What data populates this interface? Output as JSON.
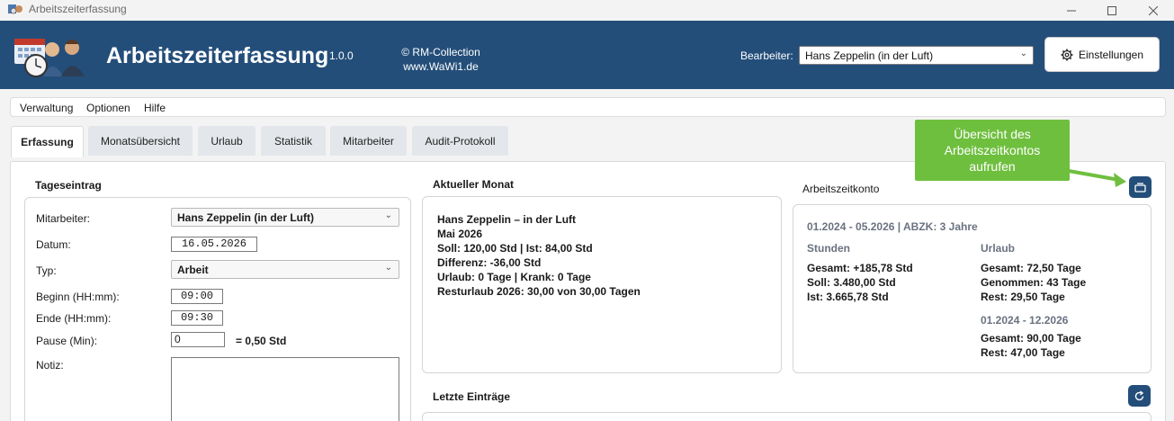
{
  "window": {
    "title": "Arbeitszeiterfassung"
  },
  "header": {
    "app_title": "Arbeitszeiterfassung",
    "version": "1.0.0",
    "copyright_line1": "© RM-Collection",
    "copyright_line2": "www.WaWi1.de",
    "editor_label": "Bearbeiter:",
    "editor_value": "Hans Zeppelin (in der Luft)",
    "settings_label": "Einstellungen"
  },
  "menu": {
    "items": [
      "Verwaltung",
      "Optionen",
      "Hilfe"
    ]
  },
  "tabs": [
    {
      "label": "Erfassung",
      "active": true
    },
    {
      "label": "Monatsübersicht",
      "active": false
    },
    {
      "label": "Urlaub",
      "active": false
    },
    {
      "label": "Statistik",
      "active": false
    },
    {
      "label": "Mitarbeiter",
      "active": false
    },
    {
      "label": "Audit-Protokoll",
      "active": false
    }
  ],
  "entry": {
    "title": "Tageseintrag",
    "employee_label": "Mitarbeiter:",
    "employee_value": "Hans Zeppelin (in der Luft)",
    "date_label": "Datum:",
    "date_value": "16.05.2026",
    "type_label": "Typ:",
    "type_value": "Arbeit",
    "start_label": "Beginn (HH:mm):",
    "start_value": "09:00",
    "end_label": "Ende (HH:mm):",
    "end_value": "09:30",
    "pause_label": "Pause (Min):",
    "pause_value": "0",
    "pause_result": "= 0,50 Std",
    "note_label": "Notiz:"
  },
  "month": {
    "title": "Aktueller Monat",
    "lines": [
      "Hans Zeppelin – in der Luft",
      "Mai 2026",
      "Soll: 120,00 Std  |  Ist: 84,00 Std",
      "Differenz: -36,00 Std",
      "Urlaub: 0 Tage  |  Krank: 0 Tage",
      "Resturlaub 2026: 30,00 von 30,00 Tagen"
    ]
  },
  "account": {
    "title": "Arbeitszeitkonto",
    "period": "01.2024 - 05.2026  |  ABZK: 3 Jahre",
    "hours_title": "Stunden",
    "hours_lines": [
      "Gesamt: +185,78 Std",
      "Soll: 3.480,00 Std",
      "Ist: 3.665,78 Std"
    ],
    "vacation_title": "Urlaub",
    "vacation_lines": [
      "Gesamt: 72,50 Tage",
      "Genommen: 43 Tage",
      "Rest: 29,50 Tage"
    ],
    "period2": "01.2024 - 12.2026",
    "period2_lines": [
      "Gesamt: 90,00 Tage",
      "Rest: 47,00 Tage"
    ]
  },
  "recent": {
    "title": "Letzte Einträge"
  },
  "tooltip": {
    "text_line1": "Übersicht des",
    "text_line2": "Arbeitszeitkontos",
    "text_line3": "aufrufen"
  },
  "colors": {
    "header_bg": "#244e7a",
    "accent": "#244e7a",
    "tooltip_bg": "#6fbf3f"
  },
  "icons": {
    "app": "calendar-clock-people-logo",
    "settings": "gear-icon",
    "account_overview": "cards-icon",
    "refresh": "refresh-icon"
  }
}
